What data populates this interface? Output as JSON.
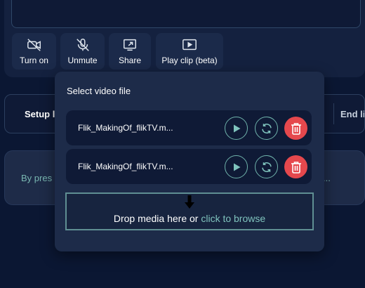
{
  "controls": {
    "camera": {
      "label": "Turn on",
      "icon": "camera-off-icon"
    },
    "mic": {
      "label": "Unmute",
      "icon": "mic-off-icon"
    },
    "share": {
      "label": "Share",
      "icon": "screen-share-icon"
    },
    "clip": {
      "label": "Play clip (beta)",
      "icon": "play-clip-icon"
    }
  },
  "steps": {
    "setup": "Setup li",
    "end": "End li"
  },
  "info": {
    "text": "By pres",
    "tail": "..."
  },
  "popup": {
    "title": "Select video file",
    "files": [
      {
        "name": "Flik_MakingOf_flikTV.m..."
      },
      {
        "name": "Flik_MakingOf_flikTV.m..."
      }
    ],
    "drop_text": "Drop media here or ",
    "drop_link": "click to browse"
  },
  "colors": {
    "background": "#0b1733",
    "panel": "#1d2b49",
    "accent": "#6fb3ab",
    "danger": "#e5484d"
  }
}
